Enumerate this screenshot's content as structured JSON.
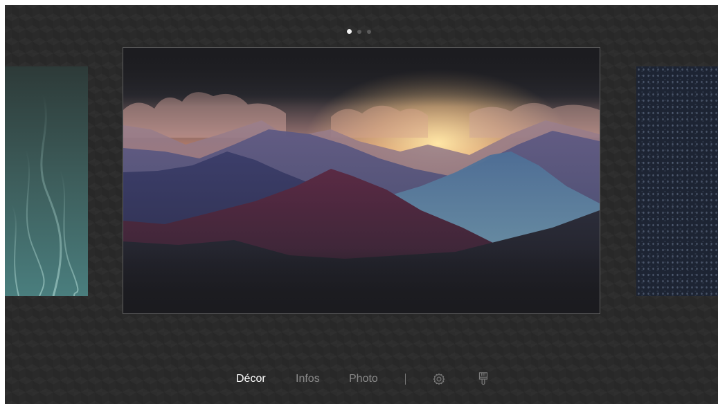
{
  "pager": {
    "pages": 3,
    "active_index": 0
  },
  "artwork": {
    "selected": "mountain-sunset",
    "previous": "teal-smoke",
    "next": "navy-pattern"
  },
  "menu": {
    "items": [
      {
        "label": "Décor",
        "active": true
      },
      {
        "label": "Infos",
        "active": false
      },
      {
        "label": "Photo",
        "active": false
      }
    ],
    "icons": [
      "gear-icon",
      "brush-icon"
    ]
  },
  "colors": {
    "background": "#2a2a2a",
    "active_text": "#ffffff",
    "inactive_text": "#8a8a8a"
  }
}
